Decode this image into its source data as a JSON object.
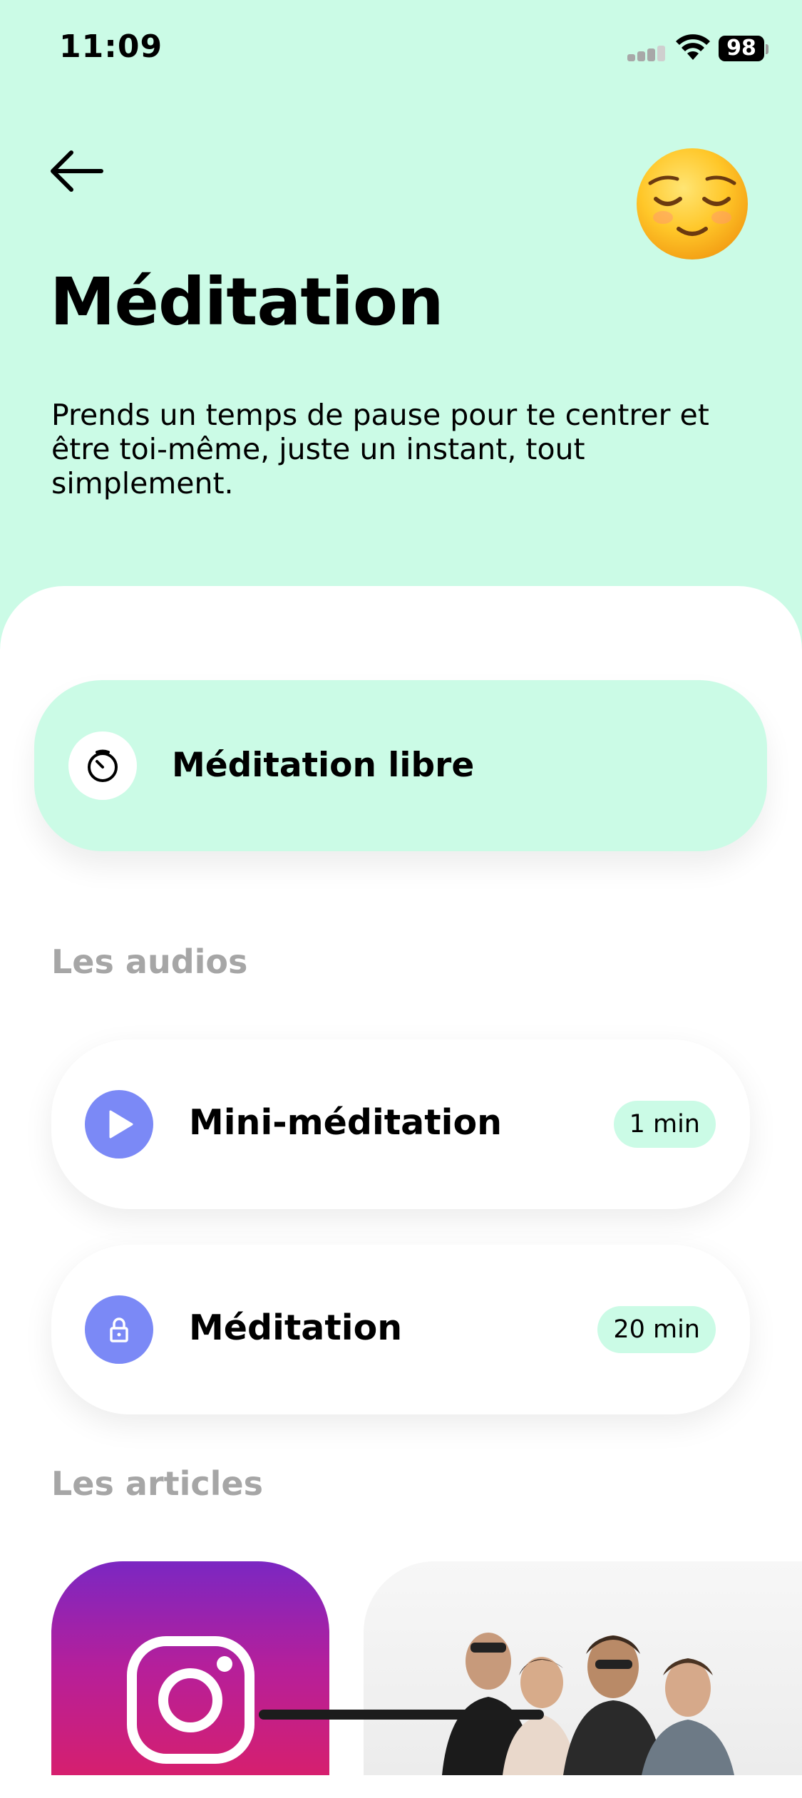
{
  "status_bar": {
    "time": "11:09",
    "battery": "98"
  },
  "header": {
    "title": "Méditation",
    "description": "Prends un temps de pause pour te centrer et être toi-même, juste un instant, tout simplement.",
    "back_icon": "arrow-left-icon",
    "emoji": "relieved-face"
  },
  "free_meditation": {
    "label": "Méditation libre",
    "icon": "timer-icon"
  },
  "audios": {
    "section_title": "Les audios",
    "items": [
      {
        "label": "Mini-méditation",
        "duration": "1 min",
        "icon": "play-icon",
        "locked": false
      },
      {
        "label": "Méditation",
        "duration": "20 min",
        "icon": "lock-icon",
        "locked": true
      }
    ]
  },
  "articles": {
    "section_title": "Les articles"
  },
  "colors": {
    "mint": "#cbfbe6",
    "accent_blue": "#7b89f6",
    "section_gray": "#a6a6a6"
  }
}
